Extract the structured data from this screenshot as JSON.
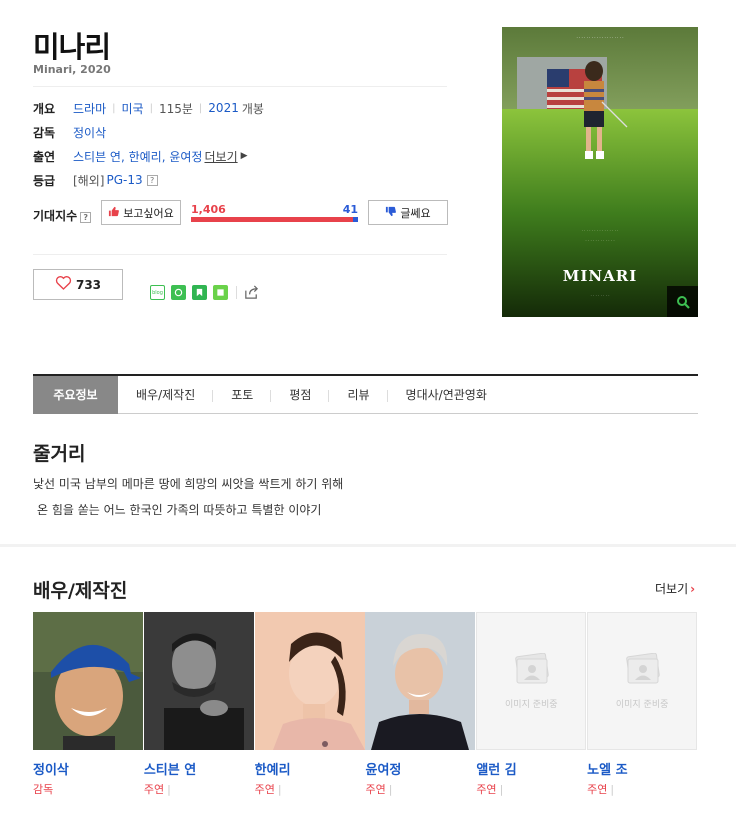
{
  "movie": {
    "title": "미나리",
    "subtitle": "Minari, 2020"
  },
  "info": {
    "overview_label": "개요",
    "genre": "드라마",
    "country": "미국",
    "runtime": "115분",
    "release_year": "2021",
    "release_suffix": "개봉",
    "director_label": "감독",
    "director": "정이삭",
    "cast_label": "출연",
    "cast_list": "스티븐 연, 한예리, 윤여정",
    "cast_more": "더보기",
    "rating_label": "등급",
    "rating_prefix": "[해외]",
    "rating": "PG-13"
  },
  "expectation": {
    "label": "기대지수",
    "want_label": "보고싶어요",
    "meh_label": "글쎄요",
    "want_count": "1,406",
    "meh_count": "41",
    "want_fraction": 0.972
  },
  "like": {
    "count": "733"
  },
  "share": {
    "blog_label": "blog"
  },
  "tabs": [
    {
      "label": "주요정보"
    },
    {
      "label": "배우/제작진"
    },
    {
      "label": "포토"
    },
    {
      "label": "평점"
    },
    {
      "label": "리뷰"
    },
    {
      "label": "명대사/연관영화"
    }
  ],
  "synopsis": {
    "title": "줄거리",
    "line1": "낯선 미국 남부의 메마른 땅에 희망의 씨앗을 싹트게 하기 위해",
    "line2": "온 힘을 쏟는 어느 한국인 가족의 따뜻하고 특별한 이야기"
  },
  "cast_section": {
    "title": "배우/제작진",
    "more": "더보기",
    "members": [
      {
        "name": "정이삭",
        "role": "감독"
      },
      {
        "name": "스티븐 연",
        "role": "주연"
      },
      {
        "name": "한예리",
        "role": "주연"
      },
      {
        "name": "윤여정",
        "role": "주연"
      },
      {
        "name": "앨런 김",
        "role": "주연"
      },
      {
        "name": "노엘 조",
        "role": "주연"
      }
    ],
    "placeholder_text": "이미지 준비중"
  },
  "poster": {
    "title": "MINARI"
  },
  "colors": {
    "link": "#1b5ac6",
    "red": "#e8424b",
    "blue": "#2a5bd7",
    "tab_active": "#888888"
  }
}
